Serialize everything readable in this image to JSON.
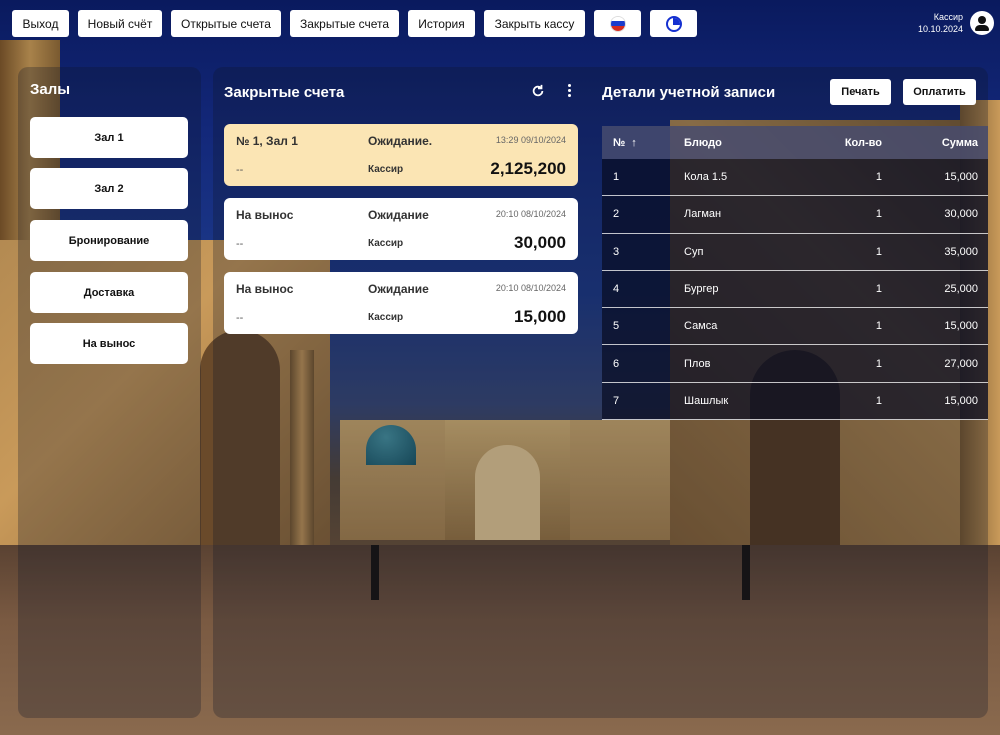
{
  "topbar": {
    "buttons": [
      "Выход",
      "Новый счёт",
      "Открытые счета",
      "Закрытые счета",
      "История",
      "Закрыть кассу"
    ],
    "user_role": "Кассир",
    "date": "10.10.2024"
  },
  "halls": {
    "title": "Залы",
    "items": [
      "Зал 1",
      "Зал 2",
      "Бронирование",
      "Доставка",
      "На вынос"
    ]
  },
  "checks_panel": {
    "title": "Закрытые счета",
    "checks": [
      {
        "name": "№ 1, Зал 1",
        "status": "Ожидание.",
        "time": "13:29 09/10/2024",
        "dash": "--",
        "role": "Кассир",
        "sum": "2,125,200",
        "selected": true
      },
      {
        "name": "На вынос",
        "status": "Ожидание",
        "time": "20:10 08/10/2024",
        "dash": "--",
        "role": "Кассир",
        "sum": "30,000",
        "selected": false
      },
      {
        "name": "На вынос",
        "status": "Ожидание",
        "time": "20:10 08/10/2024",
        "dash": "--",
        "role": "Кассир",
        "sum": "15,000",
        "selected": false
      }
    ]
  },
  "details": {
    "title": "Детали учетной записи",
    "print_label": "Печать",
    "pay_label": "Оплатить",
    "columns": {
      "no": "№",
      "dish": "Блюдо",
      "qty": "Кол-во",
      "sum": "Сумма"
    },
    "rows": [
      {
        "no": "1",
        "dish": "Кола 1.5",
        "qty": "1",
        "sum": "15,000"
      },
      {
        "no": "2",
        "dish": "Лагман",
        "qty": "1",
        "sum": "30,000"
      },
      {
        "no": "3",
        "dish": "Суп",
        "qty": "1",
        "sum": "35,000"
      },
      {
        "no": "4",
        "dish": "Бургер",
        "qty": "1",
        "sum": "25,000"
      },
      {
        "no": "5",
        "dish": "Самса",
        "qty": "1",
        "sum": "15,000"
      },
      {
        "no": "6",
        "dish": "Плов",
        "qty": "1",
        "sum": "27,000"
      },
      {
        "no": "7",
        "dish": "Шашлык",
        "qty": "1",
        "sum": "15,000"
      }
    ]
  },
  "icons": {
    "language": "russia-flag-icon",
    "theme": "theme-icon",
    "refresh": "refresh-icon",
    "more": "more-vertical-icon",
    "user": "user-avatar-icon",
    "sort": "sort-ascending-icon"
  },
  "colors": {
    "selected_check": "#fbe5b4",
    "table_header": "#464b6e",
    "theme_icon": "#1530d0"
  }
}
